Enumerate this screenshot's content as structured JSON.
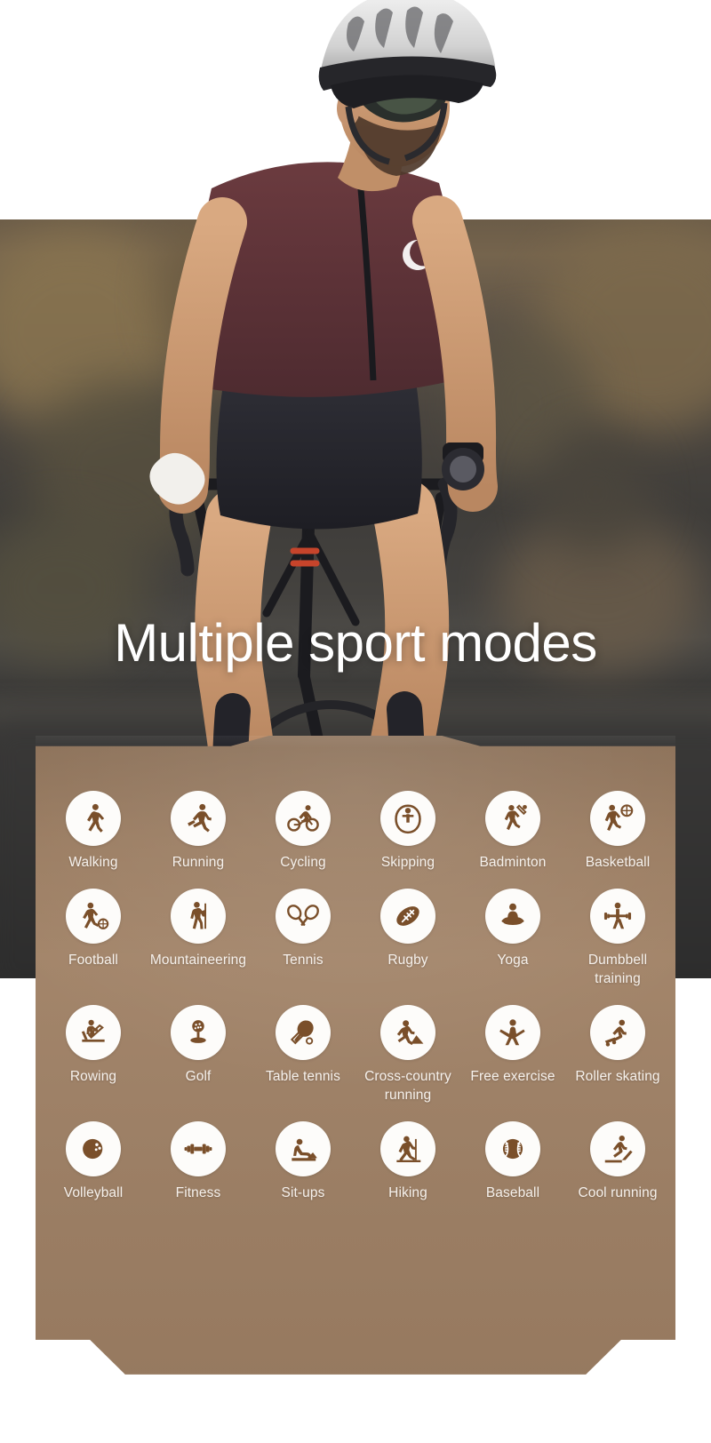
{
  "headline": "Multiple sport modes",
  "theme": {
    "panel_top": "#8a6f57",
    "panel_mid": "#a3856a",
    "panel_bottom": "#96795f",
    "icon_color": "#7a4f2a",
    "badge_bg": "#fdfcfa",
    "label_color": "#f6f1ec",
    "headline_color": "#ffffff",
    "page_bg": "#ffffff"
  },
  "sport_modes": [
    {
      "label": "Walking",
      "icon": "walking-icon"
    },
    {
      "label": "Running",
      "icon": "running-icon"
    },
    {
      "label": "Cycling",
      "icon": "cycling-icon"
    },
    {
      "label": "Skipping",
      "icon": "skipping-rope-icon"
    },
    {
      "label": "Badminton",
      "icon": "badminton-icon"
    },
    {
      "label": "Basketball",
      "icon": "basketball-icon"
    },
    {
      "label": "Football",
      "icon": "football-icon"
    },
    {
      "label": "Mountaineering",
      "icon": "mountaineering-icon"
    },
    {
      "label": "Tennis",
      "icon": "tennis-icon"
    },
    {
      "label": "Rugby",
      "icon": "rugby-icon"
    },
    {
      "label": "Yoga",
      "icon": "yoga-icon"
    },
    {
      "label": "Dumbbell training",
      "icon": "dumbbell-training-icon"
    },
    {
      "label": "Rowing",
      "icon": "rowing-icon"
    },
    {
      "label": "Golf",
      "icon": "golf-icon"
    },
    {
      "label": "Table tennis",
      "icon": "table-tennis-icon"
    },
    {
      "label": "Cross-country running",
      "icon": "cross-country-running-icon"
    },
    {
      "label": "Free exercise",
      "icon": "free-exercise-icon"
    },
    {
      "label": "Roller skating",
      "icon": "roller-skating-icon"
    },
    {
      "label": "Volleyball",
      "icon": "volleyball-icon"
    },
    {
      "label": "Fitness",
      "icon": "fitness-icon"
    },
    {
      "label": "Sit-ups",
      "icon": "sit-ups-icon"
    },
    {
      "label": "Hiking",
      "icon": "hiking-icon"
    },
    {
      "label": "Baseball",
      "icon": "baseball-icon"
    },
    {
      "label": "Cool running",
      "icon": "cool-running-icon"
    }
  ]
}
